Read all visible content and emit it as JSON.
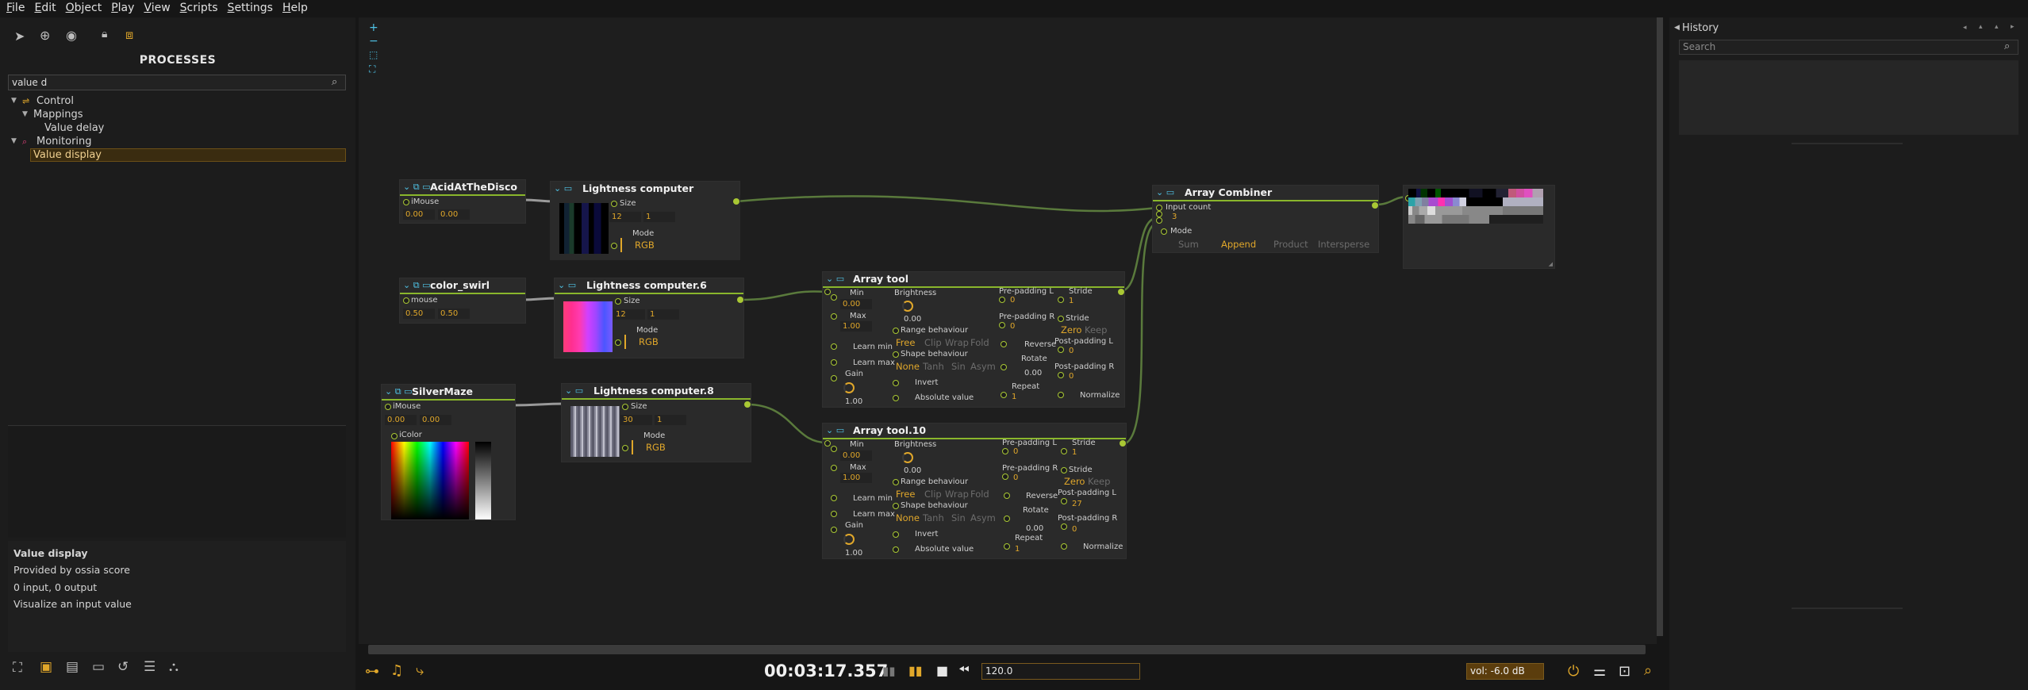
{
  "menu": [
    "File",
    "Edit",
    "Object",
    "Play",
    "View",
    "Scripts",
    "Settings",
    "Help"
  ],
  "left": {
    "title": "PROCESSES",
    "search_value": "value d",
    "tree": {
      "control": "Control",
      "mappings": "Mappings",
      "value_delay": "Value delay",
      "monitoring": "Monitoring",
      "value_display": "Value display"
    },
    "info": {
      "name": "Value display",
      "provider": "Provided by ossia score",
      "io": "0 input, 0 output",
      "desc": "Visualize an input value"
    }
  },
  "transport": {
    "time": "00:03:17.357",
    "tempo": "120.0",
    "volume": "vol: -6.0 dB"
  },
  "history": {
    "title": "History",
    "search_placeholder": "Search"
  },
  "nodes": {
    "acid": {
      "title": "AcidAtTheDisco",
      "port": "iMouse",
      "v1": "0.00",
      "v2": "0.00"
    },
    "swirl": {
      "title": "color_swirl",
      "port": "mouse",
      "v1": "0.50",
      "v2": "0.50"
    },
    "maze": {
      "title": "SilverMaze",
      "port": "iMouse",
      "v1": "0.00",
      "v2": "0.00",
      "color_label": "iColor"
    },
    "lc1": {
      "title": "Lightness computer",
      "size": "Size",
      "w": "12",
      "h": "1",
      "mode": "Mode",
      "rgb": "RGB"
    },
    "lc6": {
      "title": "Lightness computer.6",
      "size": "Size",
      "w": "12",
      "h": "1",
      "mode": "Mode",
      "rgb": "RGB"
    },
    "lc8": {
      "title": "Lightness computer.8",
      "size": "Size",
      "w": "30",
      "h": "1",
      "mode": "Mode",
      "rgb": "RGB"
    },
    "at": {
      "title": "Array tool",
      "min": "Min",
      "min_v": "0.00",
      "max": "Max",
      "max_v": "1.00",
      "learn_min": "Learn min",
      "learn_max": "Learn max",
      "gain": "Gain",
      "gain_v": "1.00",
      "brightness": "Brightness",
      "bright_v": "0.00",
      "range": "Range behaviour",
      "r_free": "Free",
      "r_clip": "Clip",
      "r_wrap": "Wrap",
      "r_fold": "Fold",
      "shape": "Shape behaviour",
      "s_none": "None",
      "s_tanh": "Tanh",
      "s_sin": "Sin",
      "s_asym": "Asym",
      "invert": "Invert",
      "absval": "Absolute value",
      "pplL": "Pre-padding L",
      "pplL_v": "0",
      "pplR": "Pre-padding R",
      "pplR_v": "0",
      "reverse": "Reverse",
      "rotate": "Rotate",
      "rotate_v": "0.00",
      "repeat": "Repeat",
      "repeat_v": "1",
      "stride1": "Stride",
      "stride1_v": "1",
      "stride2": "Stride",
      "zero": "Zero",
      "keep": "Keep",
      "postL": "Post-padding L",
      "postL_v": "0",
      "postR": "Post-padding R",
      "postR_v": "0",
      "normalize": "Normalize"
    },
    "at10": {
      "title": "Array tool.10",
      "min": "Min",
      "min_v": "0.00",
      "max": "Max",
      "max_v": "1.00",
      "learn_min": "Learn min",
      "learn_max": "Learn max",
      "gain": "Gain",
      "gain_v": "1.00",
      "brightness": "Brightness",
      "bright_v": "0.00",
      "range": "Range behaviour",
      "r_free": "Free",
      "r_clip": "Clip",
      "r_wrap": "Wrap",
      "r_fold": "Fold",
      "shape": "Shape behaviour",
      "s_none": "None",
      "s_tanh": "Tanh",
      "s_sin": "Sin",
      "s_asym": "Asym",
      "invert": "Invert",
      "absval": "Absolute value",
      "pplL": "Pre-padding L",
      "pplL_v": "0",
      "pplR": "Pre-padding R",
      "pplR_v": "0",
      "reverse": "Reverse",
      "rotate": "Rotate",
      "rotate_v": "0.00",
      "repeat": "Repeat",
      "repeat_v": "1",
      "stride1": "Stride",
      "stride1_v": "1",
      "stride2": "Stride",
      "zero": "Zero",
      "keep": "Keep",
      "postL": "Post-padding L",
      "postL_v": "27",
      "postR": "Post-padding R",
      "postR_v": "0",
      "normalize": "Normalize"
    },
    "comb": {
      "title": "Array Combiner",
      "input_count": "Input count",
      "count_v": "3",
      "mode": "Mode",
      "sum": "Sum",
      "append": "Append",
      "product": "Product",
      "intersperse": "Intersperse"
    }
  },
  "colors": {
    "accent": "#e0a72a",
    "wire": "#5a7a3c",
    "port": "#a9c834",
    "teal": "#4fc3e6"
  }
}
